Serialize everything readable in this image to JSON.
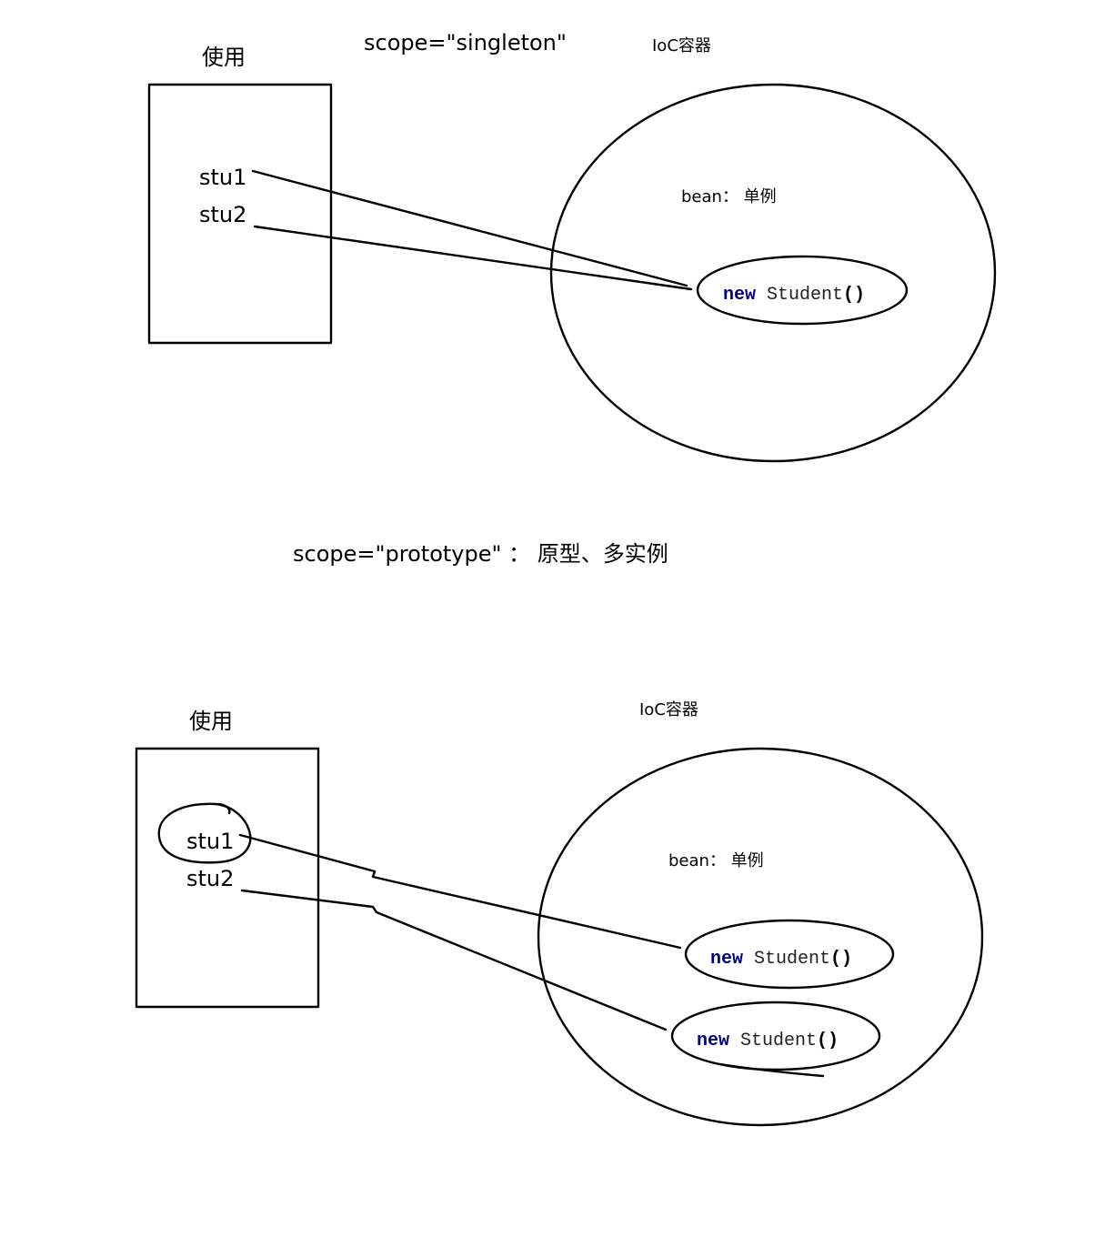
{
  "top": {
    "scope_label": "scope=\"singleton\"",
    "usage_title": "使用",
    "container_title": "IoC容器",
    "refs": [
      "stu1",
      "stu2"
    ],
    "bean_label": "bean： 单例",
    "instances": [
      {
        "keyword": "new",
        "class_name": "Student",
        "parens": "()"
      }
    ]
  },
  "bottom": {
    "scope_label": "scope=\"prototype\"  ： 原型、多实例",
    "usage_title": "使用",
    "container_title": "IoC容器",
    "refs": [
      "stu1",
      "stu2"
    ],
    "bean_label": "bean： 单例",
    "instances": [
      {
        "keyword": "new",
        "class_name": "Student",
        "parens": "()"
      },
      {
        "keyword": "new",
        "class_name": "Student",
        "parens": "()"
      }
    ]
  }
}
